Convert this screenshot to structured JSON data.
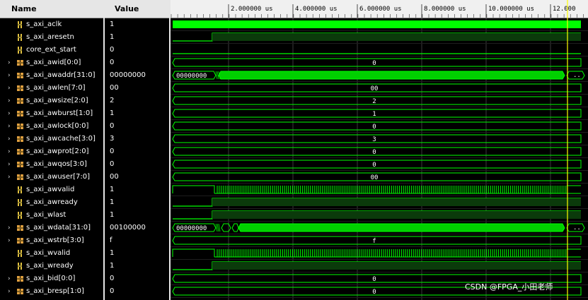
{
  "headers": {
    "name": "Name",
    "value": "Value"
  },
  "ruler": {
    "labels": [
      "2.000000 us",
      "4.000000 us",
      "6.000000 us",
      "8.000000 us",
      "10.000000 us",
      "12.000"
    ]
  },
  "signals": [
    {
      "name": "s_axi_aclk",
      "value": "1",
      "kind": "clk",
      "expandable": false
    },
    {
      "name": "s_axi_aresetn",
      "value": "1",
      "kind": "step",
      "expandable": false
    },
    {
      "name": "core_ext_start",
      "value": "0",
      "kind": "low",
      "expandable": false
    },
    {
      "name": "s_axi_awid[0:0]",
      "value": "0",
      "kind": "bus",
      "expandable": true,
      "wave_label": "0"
    },
    {
      "name": "s_axi_awaddr[31:0]",
      "value": "00000000",
      "kind": "addr",
      "expandable": true,
      "wave_label": "00000000"
    },
    {
      "name": "s_axi_awlen[7:0]",
      "value": "00",
      "kind": "bus",
      "expandable": true,
      "wave_label": "00"
    },
    {
      "name": "s_axi_awsize[2:0]",
      "value": "2",
      "kind": "bus",
      "expandable": true,
      "wave_label": "2"
    },
    {
      "name": "s_axi_awburst[1:0]",
      "value": "1",
      "kind": "bus",
      "expandable": true,
      "wave_label": "1"
    },
    {
      "name": "s_axi_awlock[0:0]",
      "value": "0",
      "kind": "bus",
      "expandable": true,
      "wave_label": "0"
    },
    {
      "name": "s_axi_awcache[3:0]",
      "value": "3",
      "kind": "bus",
      "expandable": true,
      "wave_label": "3"
    },
    {
      "name": "s_axi_awprot[2:0]",
      "value": "0",
      "kind": "bus",
      "expandable": true,
      "wave_label": "0"
    },
    {
      "name": "s_axi_awqos[3:0]",
      "value": "0",
      "kind": "bus",
      "expandable": true,
      "wave_label": "0"
    },
    {
      "name": "s_axi_awuser[7:0]",
      "value": "00",
      "kind": "bus",
      "expandable": true,
      "wave_label": "00"
    },
    {
      "name": "s_axi_awvalid",
      "value": "1",
      "kind": "toggle",
      "expandable": false
    },
    {
      "name": "s_axi_awready",
      "value": "1",
      "kind": "step",
      "expandable": false
    },
    {
      "name": "s_axi_wlast",
      "value": "1",
      "kind": "step",
      "expandable": false
    },
    {
      "name": "s_axi_wdata[31:0]",
      "value": "00100000",
      "kind": "data",
      "expandable": true,
      "wave_label": "00000000"
    },
    {
      "name": "s_axi_wstrb[3:0]",
      "value": "f",
      "kind": "bus",
      "expandable": true,
      "wave_label": "f"
    },
    {
      "name": "s_axi_wvalid",
      "value": "1",
      "kind": "toggle",
      "expandable": false
    },
    {
      "name": "s_axi_wready",
      "value": "1",
      "kind": "step",
      "expandable": false
    },
    {
      "name": "s_axi_bid[0:0]",
      "value": "0",
      "kind": "bus",
      "expandable": true,
      "wave_label": "0"
    },
    {
      "name": "s_axi_bresp[1:0]",
      "value": "0",
      "kind": "bus",
      "expandable": true,
      "wave_label": "0"
    }
  ],
  "colors": {
    "wave": "#00ff00",
    "bus_fill": "#00d000",
    "grid": "#3a3a3a",
    "cursor": "#ffff00",
    "digital_icon": "#e0c040",
    "bus_icon": "#e0a040"
  },
  "watermark": "CSDN @FPGA_小田老师"
}
